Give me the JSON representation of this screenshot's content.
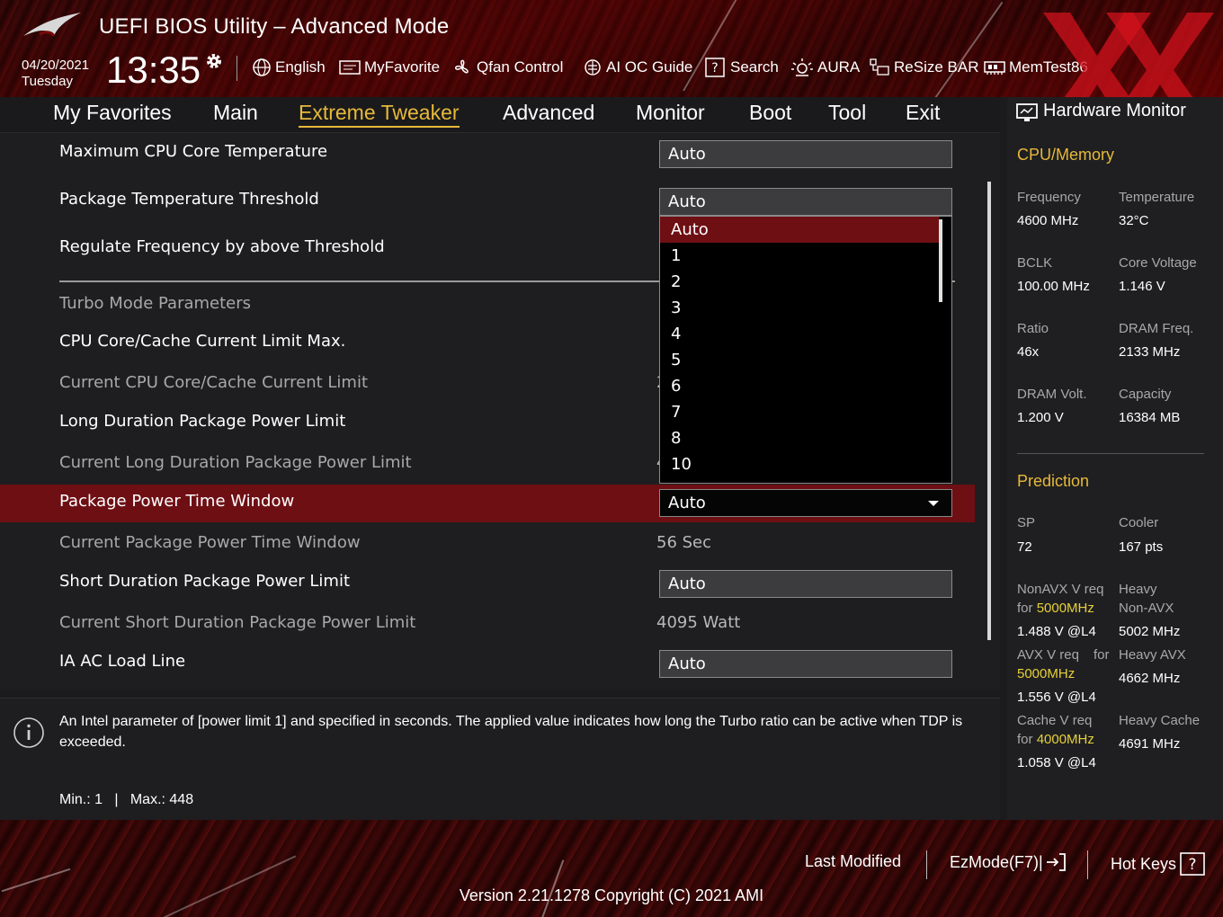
{
  "header": {
    "title": "UEFI BIOS Utility – Advanced Mode",
    "date": "04/20/2021",
    "day": "Tuesday",
    "time": "13:35",
    "tools": [
      {
        "label": "English",
        "icon": "globe-icon"
      },
      {
        "label": "MyFavorite",
        "icon": "favorite-icon"
      },
      {
        "label": "Qfan Control",
        "icon": "fan-icon"
      },
      {
        "label": "AI OC Guide",
        "icon": "ai-chip-icon"
      },
      {
        "label": "Search",
        "icon": "search-help-icon"
      },
      {
        "label": "AURA",
        "icon": "aura-light-icon"
      },
      {
        "label": "ReSize BAR",
        "icon": "resize-bar-icon"
      },
      {
        "label": "MemTest86",
        "icon": "memtest-icon"
      }
    ]
  },
  "tabs": [
    {
      "label": "My Favorites"
    },
    {
      "label": "Main"
    },
    {
      "label": "Extreme Tweaker",
      "active": true
    },
    {
      "label": "Advanced"
    },
    {
      "label": "Monitor"
    },
    {
      "label": "Boot"
    },
    {
      "label": "Tool"
    },
    {
      "label": "Exit"
    }
  ],
  "settings": {
    "max_cpu_core_temp": {
      "label": "Maximum CPU Core Temperature",
      "value": "Auto"
    },
    "pkg_temp_threshold": {
      "label": "Package Temperature Threshold",
      "value": "Auto"
    },
    "regulate_freq": {
      "label": "Regulate Frequency by above Threshold"
    },
    "turbo_section": {
      "label": "Turbo Mode Parameters"
    },
    "cpu_cache_current_max": {
      "label": "CPU Core/Cache Current Limit Max."
    },
    "current_cpu_cache_limit": {
      "label": "Current CPU Core/Cache Current Limit",
      "value": "2"
    },
    "long_duration_pl": {
      "label": "Long Duration Package Power Limit"
    },
    "current_long_pl": {
      "label": "Current Long Duration Package Power Limit",
      "value": "4"
    },
    "pkg_power_time_window": {
      "label": "Package Power Time Window",
      "value": "Auto"
    },
    "current_pkg_time_window": {
      "label": "Current Package Power Time Window",
      "value": "56 Sec"
    },
    "short_duration_pl": {
      "label": "Short Duration Package Power Limit",
      "value": "Auto"
    },
    "current_short_pl": {
      "label": "Current Short Duration Package Power Limit",
      "value": "4095 Watt"
    },
    "ia_ac_load_line": {
      "label": "IA AC Load Line",
      "value": "Auto"
    }
  },
  "dropdown": {
    "options": [
      "Auto",
      "1",
      "2",
      "3",
      "4",
      "5",
      "6",
      "7",
      "8",
      "10"
    ],
    "selected": "Auto"
  },
  "help": {
    "text": "An Intel parameter of [power limit 1] and specified in seconds. The applied value indicates how long the Turbo ratio can be active when TDP is exceeded.",
    "minmax": "Min.: 1   |   Max.: 448"
  },
  "hw_monitor": {
    "title": "Hardware Monitor",
    "cpu_memory": {
      "heading": "CPU/Memory",
      "items": [
        {
          "label": "Frequency",
          "value": "4600 MHz"
        },
        {
          "label": "Temperature",
          "value": "32°C"
        },
        {
          "label": "BCLK",
          "value": "100.00 MHz"
        },
        {
          "label": "Core Voltage",
          "value": "1.146 V"
        },
        {
          "label": "Ratio",
          "value": "46x"
        },
        {
          "label": "DRAM Freq.",
          "value": "2133 MHz"
        },
        {
          "label": "DRAM Volt.",
          "value": "1.200 V"
        },
        {
          "label": "Capacity",
          "value": "16384 MB"
        }
      ]
    },
    "prediction": {
      "heading": "Prediction",
      "sp_label": "SP",
      "sp_value": "72",
      "cooler_label": "Cooler",
      "cooler_value": "167 pts",
      "nonavx_label": "NonAVX V req",
      "nonavx_for": "for",
      "nonavx_freq": "5000MHz",
      "nonavx_value": "1.488 V @L4",
      "heavy_nonavx_label1": "Heavy",
      "heavy_nonavx_label2": "Non-AVX",
      "heavy_nonavx_value": "5002 MHz",
      "avx_label": "AVX V req",
      "avx_for": "for",
      "avx_freq": "5000MHz",
      "avx_value": "1.556 V @L4",
      "heavy_avx_label": "Heavy AVX",
      "heavy_avx_value": "4662 MHz",
      "cache_label": "Cache V req",
      "cache_for": "for",
      "cache_freq": "4000MHz",
      "cache_value": "1.058 V @L4",
      "heavy_cache_label": "Heavy Cache",
      "heavy_cache_value": "4691 MHz"
    }
  },
  "footer": {
    "last_modified": "Last Modified",
    "ezmode": "EzMode(F7)|",
    "hot_keys": "Hot Keys",
    "version": "Version 2.21.1278 Copyright (C) 2021 AMI"
  },
  "colors": {
    "accent": "#e6b93a",
    "selection": "#6e0f14",
    "highlight": "#e6d03a"
  }
}
